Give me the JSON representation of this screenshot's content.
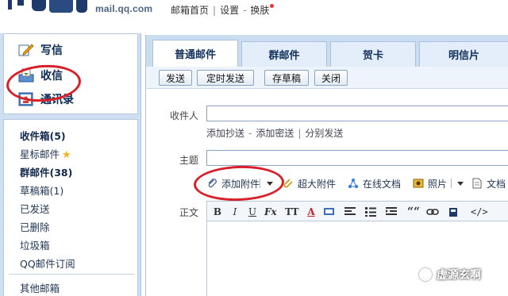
{
  "header": {
    "domain": "mail.qq.com",
    "links": [
      "邮箱首页",
      "设置",
      "换肤"
    ]
  },
  "sidebar": {
    "actions": [
      {
        "label": "写信",
        "icon": "pencil-icon"
      },
      {
        "label": "收信",
        "icon": "inbox-tray-icon"
      },
      {
        "label": "通讯录",
        "icon": "contacts-icon"
      }
    ],
    "folders": [
      {
        "label": "收件箱(5)",
        "bold": true
      },
      {
        "label": "星标邮件",
        "bold": false,
        "star": true
      },
      {
        "label": "群邮件(38)",
        "bold": true
      },
      {
        "label": "草稿箱(1)",
        "bold": false
      },
      {
        "label": "已发送",
        "bold": false
      },
      {
        "label": "已删除",
        "bold": false
      },
      {
        "label": "垃圾箱",
        "bold": false
      },
      {
        "label": "QQ邮件订阅",
        "bold": false
      },
      {
        "label": "其他邮箱",
        "bold": false
      }
    ]
  },
  "compose": {
    "tabs": [
      "普通邮件",
      "群邮件",
      "贺卡",
      "明信片"
    ],
    "active_tab": "普通邮件",
    "buttons": [
      "发送",
      "定时发送",
      "存草稿",
      "关闭"
    ],
    "recipient_label": "收件人",
    "recipient_value": "",
    "cc_links": [
      "添加抄送",
      "添加密送",
      "分别发送"
    ],
    "subject_label": "主题",
    "subject_value": "",
    "attachments": [
      {
        "label": "添加附件",
        "icon": "paperclip-icon",
        "dropdown": true
      },
      {
        "label": "超大附件",
        "icon": "large-attachment-icon",
        "dropdown": false
      },
      {
        "label": "在线文档",
        "icon": "online-doc-icon",
        "dropdown": false
      },
      {
        "label": "照片",
        "icon": "photo-icon",
        "dropdown": true
      },
      {
        "label": "文档",
        "icon": "document-icon",
        "dropdown": false
      }
    ],
    "body_label": "正文",
    "toolbar": [
      "B",
      "I",
      "U",
      "Fx",
      "TT",
      "A",
      "bg",
      "align",
      "list",
      "indent",
      "““",
      "link",
      "music",
      "</>"
    ]
  },
  "watermark": "虚源玄啊",
  "colors": {
    "annotation_red": "#d8202a",
    "sidebar_bg": "#cfdff2",
    "tab_bg": "#c9dcf0",
    "text_dark": "#12305a"
  }
}
